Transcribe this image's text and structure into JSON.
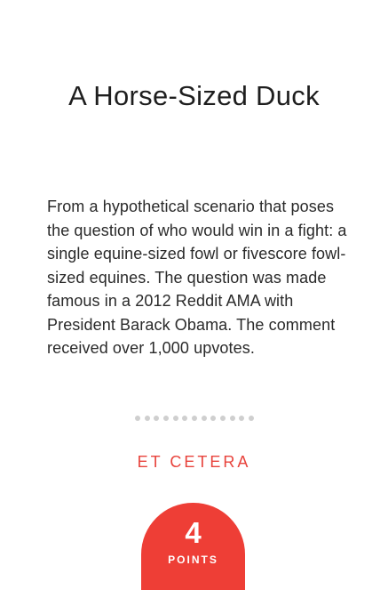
{
  "card": {
    "title": "A Horse-Sized Duck",
    "description": "From a hypothetical scenario that poses the question of who would win in a fight: a single equine-sized fowl or fivescore fowl-sized equines. The question was made famous in a 2012 Reddit AMA with President Barack Obama. The comment received over 1,000 upvotes.",
    "category": "ET CETERA",
    "points": {
      "value": "4",
      "label": "POINTS"
    },
    "divider_dot_count": 13
  },
  "colors": {
    "accent": "#ee3e36",
    "category_text": "#e8433c",
    "divider_dots": "#cfcfcf",
    "text": "#222222",
    "background": "#ffffff"
  }
}
